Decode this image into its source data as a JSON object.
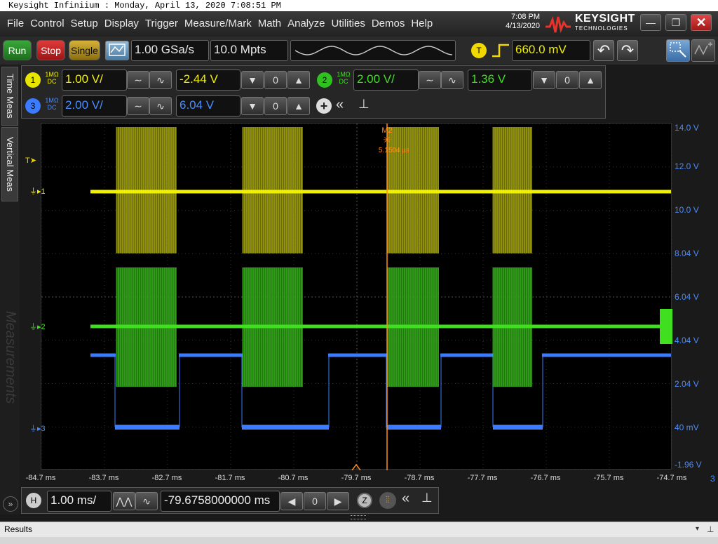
{
  "window_title": "Keysight Infiniium : Monday, April 13, 2020 7:08:51 PM",
  "menu": [
    "File",
    "Control",
    "Setup",
    "Display",
    "Trigger",
    "Measure/Mark",
    "Math",
    "Analyze",
    "Utilities",
    "Demos",
    "Help"
  ],
  "clock": {
    "time": "7:08 PM",
    "date": "4/13/2020"
  },
  "brand": {
    "name": "KEYSIGHT",
    "sub": "TECHNOLOGIES"
  },
  "window_buttons": {
    "minimize": "—",
    "restore": "❐",
    "close": "✕"
  },
  "toolbar": {
    "run": "Run",
    "stop": "Stop",
    "single": "Single",
    "sample_rate": "1.00 GSa/s",
    "memory_depth": "10.0 Mpts",
    "trigger_badge": "T",
    "trigger_level": "660.0 mV"
  },
  "channels": [
    {
      "num": "1",
      "imp": "1MΩ",
      "coupling": "DC",
      "scale": "1.00 V/",
      "offset": "-2.44 V",
      "color": "#f0f000"
    },
    {
      "num": "2",
      "imp": "1MΩ",
      "coupling": "DC",
      "scale": "2.00 V/",
      "offset": "1.36 V",
      "color": "#40e020"
    },
    {
      "num": "3",
      "imp": "1MΩ",
      "coupling": "DC",
      "scale": "2.00 V/",
      "offset": "6.04 V",
      "color": "#3b7bff"
    }
  ],
  "side_tabs": [
    "Time Meas",
    "Vertical Meas",
    "Measurements"
  ],
  "graticule": {
    "y_labels": [
      "14.0 V",
      "12.0 V",
      "10.0 V",
      "8.04 V",
      "6.04 V",
      "4.04 V",
      "2.04 V",
      "40 mV",
      "-1.96 V"
    ],
    "x_labels": [
      "-84.7 ms",
      "-83.7 ms",
      "-82.7 ms",
      "-81.7 ms",
      "-80.7 ms",
      "-79.7 ms",
      "-78.7 ms",
      "-77.7 ms",
      "-76.7 ms",
      "-75.7 ms",
      "-74.7 ms"
    ],
    "right_marker": "3",
    "trigger_marker": "T",
    "ch_markers": [
      "1",
      "2",
      "3"
    ],
    "marker": {
      "name": "M2",
      "value": "5.1504 µs"
    }
  },
  "horizontal": {
    "badge": "H",
    "scale": "1.00 ms/",
    "position": "-79.6758000000 ms",
    "zoom_badge": "Z"
  },
  "results_label": "Results",
  "colors": {
    "ch1": "#f0f000",
    "ch2": "#40e020",
    "ch3": "#3b7bff",
    "marker": "#ff8c1a",
    "axis": "#4a8cff"
  }
}
